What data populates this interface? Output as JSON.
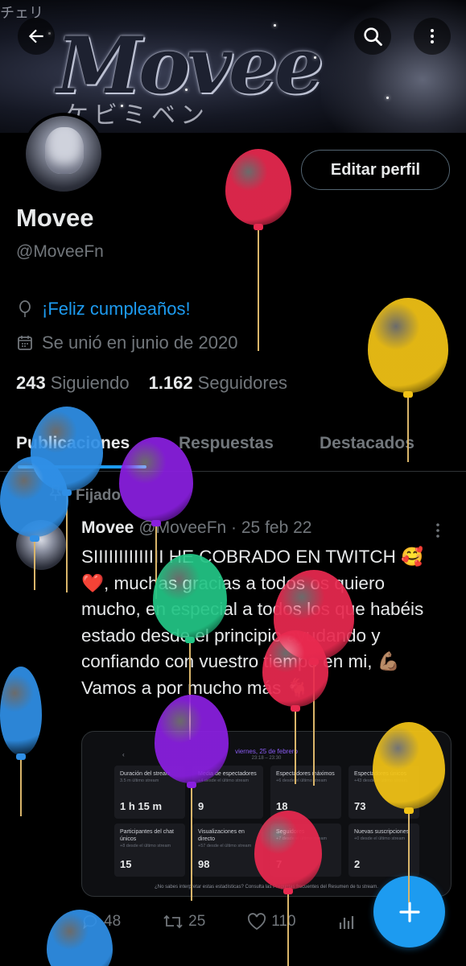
{
  "header": {
    "banner_title": "Movee",
    "banner_subtitle": "ケビミベン",
    "banner_top_text": "チェリ"
  },
  "profile": {
    "edit_button": "Editar perfil",
    "name": "Movee",
    "handle": "@MoveeFn",
    "birthday": "¡Feliz cumpleaños!",
    "joined": "Se unió en junio de 2020",
    "following_count": "243",
    "following_label": "Siguiendo",
    "followers_count": "1.162",
    "followers_label": "Seguidores"
  },
  "tabs": [
    {
      "label": "Publicaciones"
    },
    {
      "label": "Respuestas"
    },
    {
      "label": "Destacados"
    }
  ],
  "post": {
    "pinned_label": "Fijado",
    "author": "Movee",
    "handle_date": "@MoveeFn · 25 feb 22",
    "text": "SIIIIIIIIIIIIII HE COBRADO EN TWITCH 🥰 ❤️, muchas gracias a todos os quiero mucho, en especial a todos los que habéis estado desde el principio ayudando y confiando con vuestro tiempo en mi, 💪🏽 Vamos a por mucho más 🐐",
    "media": {
      "date_title": "viernes, 25 de febrero",
      "time_range": "23:18 – 23:30",
      "cards": [
        {
          "label": "Duración del stream",
          "note": "3.5 m último stream",
          "value": "1 h 15 m"
        },
        {
          "label": "Media de espectadores",
          "note": "+4 desde el último stream",
          "value": "9"
        },
        {
          "label": "Espectadores máximos",
          "note": "+6 desde el último stream",
          "value": "18"
        },
        {
          "label": "Espectadores únicos",
          "note": "+43 desde el último stream",
          "value": "73"
        },
        {
          "label": "Participantes del chat únicos",
          "note": "+8 desde el último stream",
          "value": "15"
        },
        {
          "label": "Visualizaciones en directo",
          "note": "+57 desde el último stream",
          "value": "98"
        },
        {
          "label": "Seguidores",
          "note": "+7 desde el último stream",
          "value": "7"
        },
        {
          "label": "Nuevas suscripciones",
          "note": "+0 desde el último stream",
          "value": "2"
        }
      ],
      "footer": "¿No sabes interpretar estas estadísticas? Consulta las Preguntas frecuentes del Resumen de tu stream."
    },
    "replies": "48",
    "retweets": "25",
    "likes": "110"
  },
  "colors": {
    "accent": "#1d9bf0",
    "muted": "#71767b",
    "text": "#e7e9ea",
    "balloon_red": "#e8294f",
    "balloon_yellow": "#f2c315",
    "balloon_blue": "#2f8fe6",
    "balloon_purple": "#8a1fe0",
    "balloon_green": "#22c585"
  },
  "icons": [
    "back-arrow-icon",
    "search-icon",
    "more-vertical-icon",
    "balloon-icon",
    "calendar-icon",
    "pin-icon",
    "reply-icon",
    "retweet-icon",
    "like-icon",
    "analytics-icon",
    "plus-icon"
  ]
}
